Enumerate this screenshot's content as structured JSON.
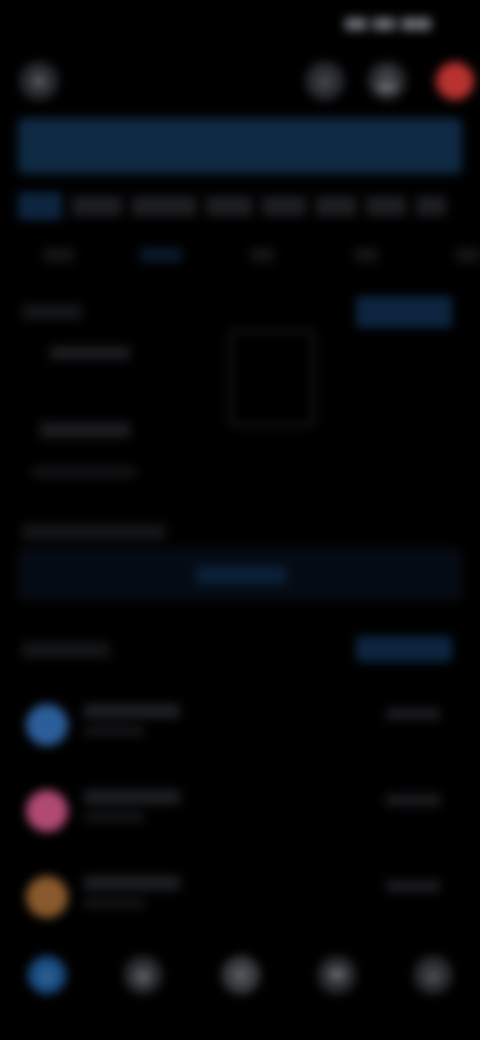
{
  "status_bar": {
    "time": "",
    "icons": [
      "signal-icon",
      "wifi-icon",
      "battery-icon"
    ]
  },
  "top_bar": {
    "menu_icon": "menu-icon",
    "actions": [
      "search-icon",
      "bell-icon",
      "avatar"
    ]
  },
  "search": {
    "placeholder": ""
  },
  "tabs": [
    "",
    "",
    "",
    "",
    "",
    "",
    "",
    ""
  ],
  "subtabs": [
    "",
    "",
    "",
    "",
    ""
  ],
  "schedule": {
    "title": "",
    "button_label": "",
    "items": [
      "",
      ""
    ],
    "footnote": "",
    "calendar": {
      "month": "",
      "day": ""
    }
  },
  "highlight": {
    "title": "",
    "banner_label": ""
  },
  "activity": {
    "title": "",
    "button_label": "",
    "rows": [
      {
        "title": "",
        "subtitle": "",
        "time": "",
        "avatar_color": "#2c5e9a"
      },
      {
        "title": "",
        "subtitle": "",
        "time": "",
        "avatar_color": "#b04a74"
      },
      {
        "title": "",
        "subtitle": "",
        "time": "",
        "avatar_color": "#8a5a2e"
      }
    ]
  },
  "bottom_nav": [
    "home-icon",
    "explore-icon",
    "add-icon",
    "messages-icon",
    "profile-icon"
  ],
  "colors": {
    "accent": "#1a4f86",
    "background": "#000000",
    "danger": "#b8332f"
  }
}
